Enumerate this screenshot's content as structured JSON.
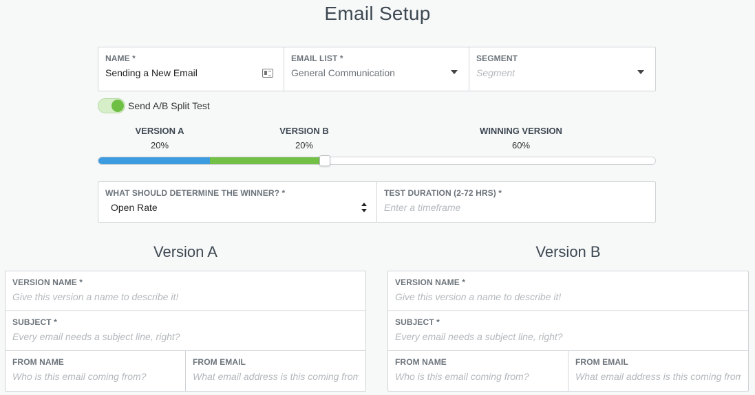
{
  "page_title": "Email Setup",
  "top_fields": {
    "name": {
      "label": "NAME *",
      "value": "Sending a New Email",
      "icon": "contact-card-icon"
    },
    "email_list": {
      "label": "EMAIL LIST *",
      "value": "General Communication",
      "icon": "chevron-down-icon"
    },
    "segment": {
      "label": "SEGMENT",
      "placeholder": "Segment",
      "icon": "chevron-down-icon"
    }
  },
  "ab_toggle": {
    "label": "Send A/B Split Test",
    "on": true
  },
  "split": {
    "version_a": {
      "label": "VERSION A",
      "percent": "20%",
      "fraction": 0.2,
      "color": "#3d9be0"
    },
    "version_b": {
      "label": "VERSION B",
      "percent": "20%",
      "fraction": 0.2,
      "color": "#72c045"
    },
    "winning": {
      "label": "WINNING VERSION",
      "percent": "60%",
      "fraction": 0.6
    }
  },
  "winner_fields": {
    "determine": {
      "label": "WHAT SHOULD DETERMINE THE WINNER? *",
      "value": "Open Rate"
    },
    "duration": {
      "label": "TEST DURATION (2-72 HRS) *",
      "placeholder": "Enter a timeframe"
    }
  },
  "versions": [
    {
      "title": "Version A",
      "version_name": {
        "label": "VERSION NAME *",
        "placeholder": "Give this version a name to describe it!"
      },
      "subject": {
        "label": "SUBJECT *",
        "placeholder": "Every email needs a subject line, right?"
      },
      "from_name": {
        "label": "FROM NAME",
        "placeholder": "Who is this email coming from?"
      },
      "from_email": {
        "label": "FROM EMAIL",
        "placeholder": "What email address is this coming from?"
      }
    },
    {
      "title": "Version B",
      "version_name": {
        "label": "VERSION NAME *",
        "placeholder": "Give this version a name to describe it!"
      },
      "subject": {
        "label": "SUBJECT *",
        "placeholder": "Every email needs a subject line, right?"
      },
      "from_name": {
        "label": "FROM NAME",
        "placeholder": "Who is this email coming from?"
      },
      "from_email": {
        "label": "FROM EMAIL",
        "placeholder": "What email address is this coming from?"
      }
    }
  ]
}
